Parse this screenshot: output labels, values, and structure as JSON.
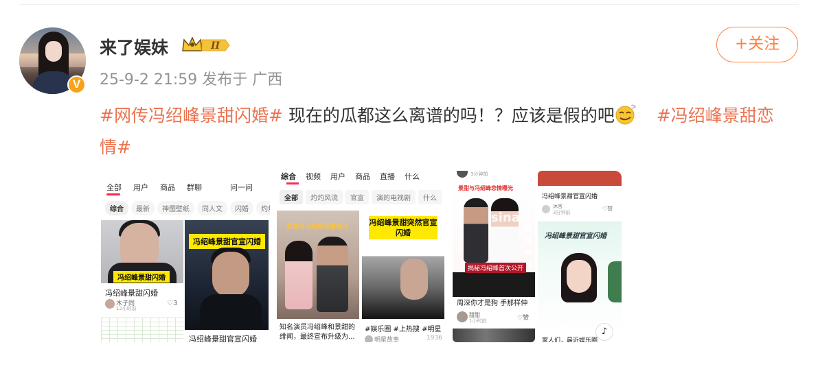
{
  "post": {
    "username": "来了娱妹",
    "meta": "25-9-2 21:59 发布于 广西",
    "follow_label": "+关注",
    "verified_badge": "V",
    "text_segments": [
      {
        "type": "tag",
        "text": "#网传冯绍峰景甜闪婚#"
      },
      {
        "type": "text",
        "text": " 现在的瓜都这么离谱的吗！？应该是假的吧"
      },
      {
        "type": "tag",
        "text": "#冯绍峰景甜恋情#"
      }
    ],
    "emoji": "smirk-emoji",
    "colors": {
      "accent": "#eb7350",
      "follow": "#ff8140",
      "meta": "#939393",
      "verified": "#f7a21b"
    }
  },
  "gallery": {
    "img1": {
      "tabs": [
        "全部",
        "用户",
        "商品",
        "群聊"
      ],
      "ask": "问一问",
      "chips": [
        "综合",
        "最新",
        "神图壁纸",
        "同人文",
        "闪婚",
        "灼灼"
      ],
      "overlay_caption": "冯绍峰景甜闪婚",
      "right_title": "冯绍峰景甜官宣闪婚",
      "card1_title": "冯绍峰景甜闪婚",
      "card1_author": "木子同",
      "card1_time": "12小时前",
      "card1_likes": "♡3",
      "card2_title": "冯绍峰景甜官宣闪婚"
    },
    "img2": {
      "tabs": [
        "综合",
        "视频",
        "用户",
        "商品",
        "直播",
        "什么"
      ],
      "chips": [
        "全部",
        "灼灼风流",
        "官宣",
        "演的电视剧",
        "什么"
      ],
      "left_overlay": "景甜与冯绍峰恋情曝光",
      "right_title": "冯绍峰景甜突然官宣闪婚",
      "left_caption": "知名演员冯绍峰和景甜的绯闻，最终宣布升级为...",
      "right_caption": "#娱乐圈 #上热搜 #明星",
      "right_author": "明星故事",
      "right_count": "1936"
    },
    "img3": {
      "header": "3分钟前",
      "overlay": "景甜与冯绍峰恋情曝光",
      "watermark": "sina新",
      "banner": "揭秘冯绍峰首次公开",
      "caption": "周深你才是狗 手那样伸",
      "author": "甜甜",
      "time": "1小时前",
      "likes": "♡赞"
    },
    "img4": {
      "title": "冯绍峰景甜官宣闪婚",
      "author": "沐言",
      "time": "3分钟前",
      "likes": "♡赞",
      "overlay_title": "冯绍峰景甜官宣闪婚",
      "bottom_caption": "家人们，最近娱乐圈",
      "tiktok": "♪"
    }
  }
}
